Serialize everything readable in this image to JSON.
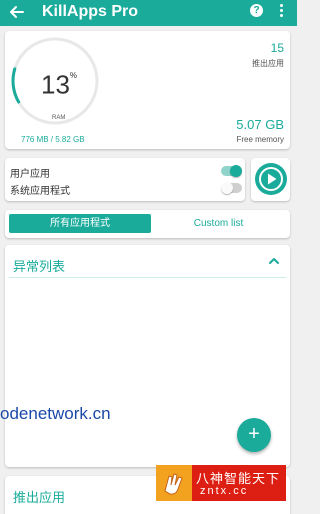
{
  "appbar": {
    "title": "KillApps Pro",
    "back_icon": "arrow-left-icon",
    "help_icon": "help-circle-icon",
    "help_glyph": "?",
    "more_icon": "more-vertical-icon"
  },
  "ram": {
    "percent": "13",
    "percent_sign": "%",
    "percent_fraction": 0.13,
    "label": "RAM",
    "detail": "776 MB / 5.82 GB",
    "killed_count": "15",
    "killed_label": "推出应用",
    "free_value": "5.07 GB",
    "free_label": "Free memory"
  },
  "toggles": {
    "user_apps_label": "用户应用",
    "user_apps_on": true,
    "system_apps_label": "系统应用程式",
    "system_apps_on": false
  },
  "kill_button": {
    "icon": "play-circle-icon"
  },
  "tabs": {
    "all_apps": "所有应用程式",
    "custom_list": "Custom list"
  },
  "exception_list": {
    "title": "异常列表",
    "chevron_icon": "chevron-up-icon",
    "fab_label": "+"
  },
  "killed_apps": {
    "title": "推出应用"
  },
  "overlays": {
    "watermark_text": "odenetwork.cn",
    "logo_text": "八神智能天下",
    "logo_sub": "zntx.cc"
  },
  "colors": {
    "accent": "#1aab9b",
    "background": "#f0f0f0",
    "track": "#e8e8e8"
  }
}
